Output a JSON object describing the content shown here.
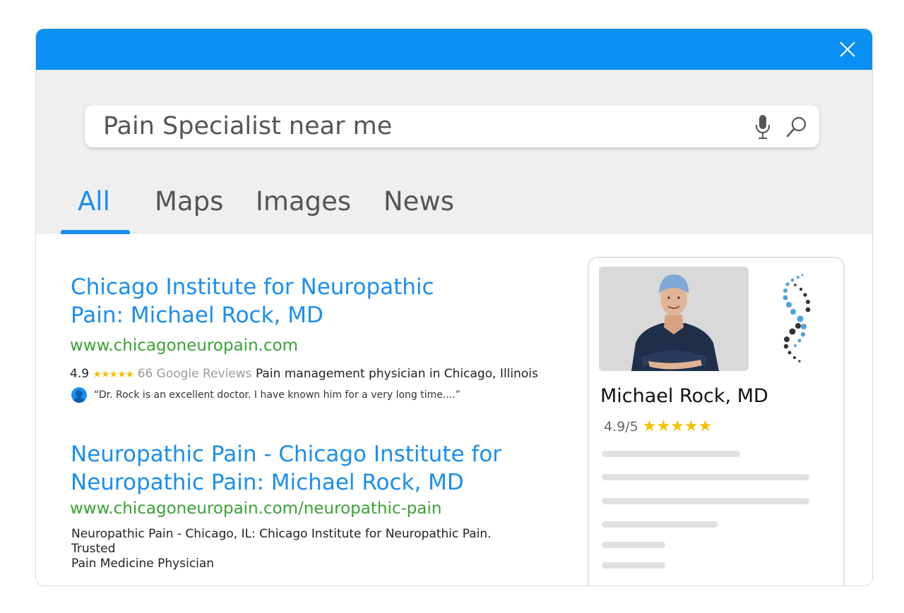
{
  "search": {
    "query": "Pain Specialist near me"
  },
  "tabs": [
    {
      "label": "All",
      "active": true
    },
    {
      "label": "Maps",
      "active": false
    },
    {
      "label": "Images",
      "active": false
    },
    {
      "label": "News",
      "active": false
    }
  ],
  "results": [
    {
      "title_line1": "Chicago Institute for Neuropathic",
      "title_line2": "Pain: Michael Rock, MD",
      "url": "www.chicagoneuropain.com",
      "rating": "4.9",
      "stars": "★★★★★",
      "reviews": "66 Google Reviews",
      "category": "Pain management physician in Chicago, Illinois",
      "review_quote": "“Dr. Rock is an excellent doctor.  I have known him for a very long time....”"
    },
    {
      "title_line1": "Neuropathic Pain - Chicago Institute for",
      "title_line2": "Neuropathic Pain: Michael Rock, MD",
      "url": "www.chicagoneuropain.com/neuropathic-pain",
      "snippet_line1": "Neuropathic Pain - Chicago, IL: Chicago Institute for Neuropathic Pain. Trusted",
      "snippet_line2": "Pain Medicine Physician"
    }
  ],
  "knowledge_panel": {
    "name": "Michael Rock, MD",
    "rating": "4.9/5",
    "stars": "★★★★★",
    "rating_value": 4.9
  },
  "colors": {
    "accent": "#1a8ef0",
    "titlebar": "#0a8ff2",
    "url_green": "#3aa232",
    "star": "#f5c000",
    "header_bg": "#efefef"
  },
  "icons": [
    "close-icon",
    "microphone-icon",
    "search-icon",
    "avatar-icon",
    "logo-icon"
  ]
}
